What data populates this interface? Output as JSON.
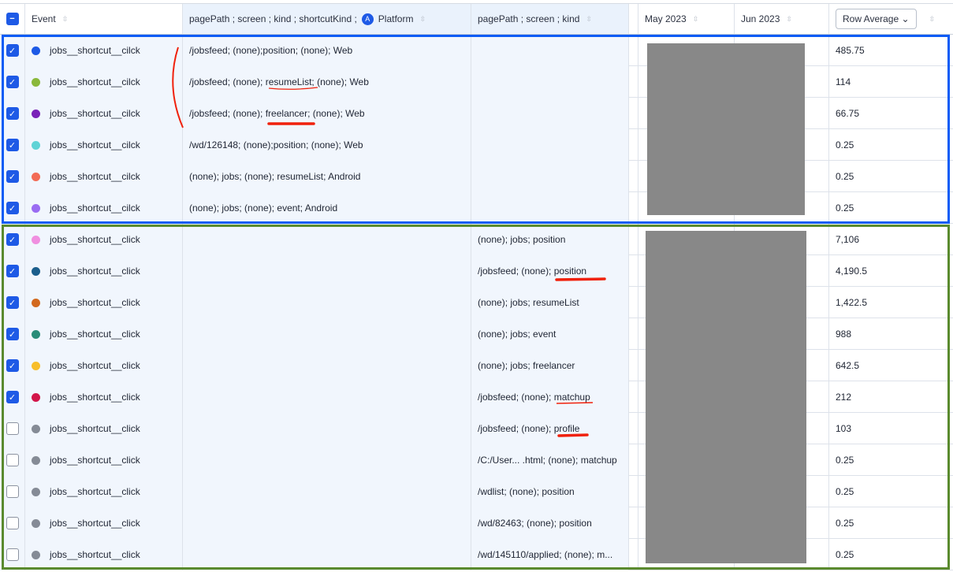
{
  "header": {
    "event": "Event",
    "col1": "pagePath ; screen ; kind ; shortcutKind ;",
    "platform": "Platform",
    "col2": "pagePath ; screen ; kind",
    "may": "May 2023",
    "jun": "Jun 2023",
    "row_average": "Row Average"
  },
  "rows": [
    {
      "checked": true,
      "color": "#1e5ae6",
      "event": "jobs__shortcut__cilck",
      "col1": "/jobsfeed; (none);position; (none); Web",
      "col2": "",
      "avg": "485.75"
    },
    {
      "checked": true,
      "color": "#8ab83a",
      "event": "jobs__shortcut__cilck",
      "col1": "/jobsfeed; (none); resumeList; (none); Web",
      "col2": "",
      "avg": "114"
    },
    {
      "checked": true,
      "color": "#7a22b8",
      "event": "jobs__shortcut__cilck",
      "col1": "/jobsfeed; (none); freelancer; (none); Web",
      "col2": "",
      "avg": "66.75"
    },
    {
      "checked": true,
      "color": "#5fd3d6",
      "event": "jobs__shortcut__cilck",
      "col1": "/wd/126148; (none);position; (none); Web",
      "col2": "",
      "avg": "0.25"
    },
    {
      "checked": true,
      "color": "#f26b55",
      "event": "jobs__shortcut__cilck",
      "col1": "(none); jobs; (none); resumeList; Android",
      "col2": "",
      "avg": "0.25"
    },
    {
      "checked": true,
      "color": "#9a6cf2",
      "event": "jobs__shortcut__cilck",
      "col1": "(none); jobs; (none); event; Android",
      "col2": "",
      "avg": "0.25"
    },
    {
      "checked": true,
      "color": "#f08fe0",
      "event": "jobs__shortcut__click",
      "col1": "",
      "col2": "(none); jobs; position",
      "avg": "7,106"
    },
    {
      "checked": true,
      "color": "#1b5e8c",
      "event": "jobs__shortcut__click",
      "col1": "",
      "col2": "/jobsfeed; (none); position",
      "avg": "4,190.5"
    },
    {
      "checked": true,
      "color": "#d2691e",
      "event": "jobs__shortcut__click",
      "col1": "",
      "col2": "(none); jobs; resumeList",
      "avg": "1,422.5"
    },
    {
      "checked": true,
      "color": "#2a8c78",
      "event": "jobs__shortcut__click",
      "col1": "",
      "col2": "(none); jobs; event",
      "avg": "988"
    },
    {
      "checked": true,
      "color": "#f7be2a",
      "event": "jobs__shortcut__click",
      "col1": "",
      "col2": "(none); jobs; freelancer",
      "avg": "642.5"
    },
    {
      "checked": true,
      "color": "#d2164a",
      "event": "jobs__shortcut__click",
      "col1": "",
      "col2": "/jobsfeed; (none); matchup",
      "avg": "212"
    },
    {
      "checked": false,
      "color": "#858b96",
      "event": "jobs__shortcut__click",
      "col1": "",
      "col2": "/jobsfeed; (none); profile",
      "avg": "103"
    },
    {
      "checked": false,
      "color": "#858b96",
      "event": "jobs__shortcut__click",
      "col1": "",
      "col2": "/C:/User... .html; (none); matchup",
      "avg": "0.25"
    },
    {
      "checked": false,
      "color": "#858b96",
      "event": "jobs__shortcut__click",
      "col1": "",
      "col2": "/wdlist; (none); position",
      "avg": "0.25"
    },
    {
      "checked": false,
      "color": "#858b96",
      "event": "jobs__shortcut__click",
      "col1": "",
      "col2": "/wd/82463; (none); position",
      "avg": "0.25"
    },
    {
      "checked": false,
      "color": "#858b96",
      "event": "jobs__shortcut__click",
      "col1": "",
      "col2": "/wd/145110/applied; (none); m...",
      "avg": "0.25"
    }
  ],
  "annotation_colors": {
    "blue_box": "#0a5cf5",
    "green_box": "#5a8a2e",
    "marker": "#f0210c"
  }
}
